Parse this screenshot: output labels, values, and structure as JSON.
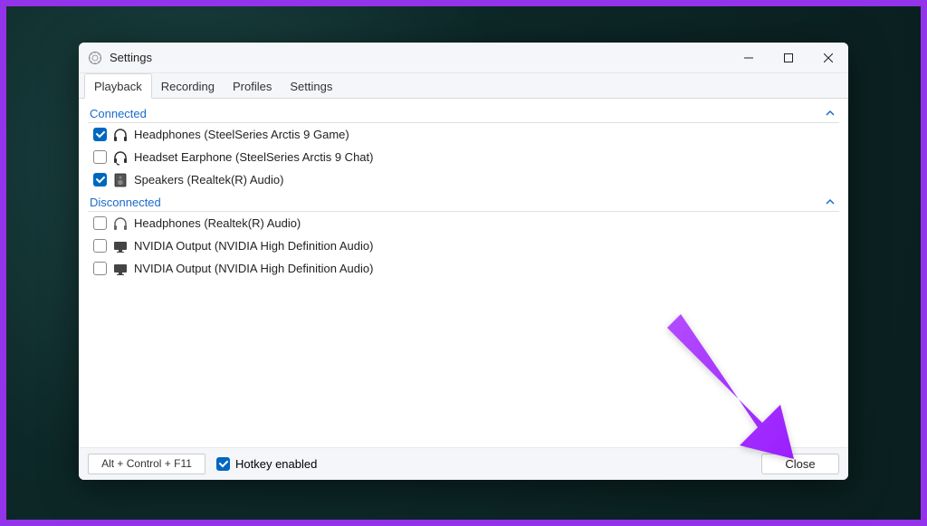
{
  "window": {
    "title": "Settings"
  },
  "tabs": [
    {
      "label": "Playback",
      "active": true
    },
    {
      "label": "Recording",
      "active": false
    },
    {
      "label": "Profiles",
      "active": false
    },
    {
      "label": "Settings",
      "active": false
    }
  ],
  "sections": {
    "connected": {
      "title": "Connected",
      "devices": [
        {
          "checked": true,
          "icon": "headphones",
          "label": "Headphones (SteelSeries Arctis 9 Game)"
        },
        {
          "checked": false,
          "icon": "headset",
          "label": "Headset Earphone (SteelSeries Arctis 9 Chat)"
        },
        {
          "checked": true,
          "icon": "speakers",
          "label": "Speakers (Realtek(R) Audio)"
        }
      ]
    },
    "disconnected": {
      "title": "Disconnected",
      "devices": [
        {
          "checked": false,
          "icon": "headphones",
          "label": "Headphones (Realtek(R) Audio)"
        },
        {
          "checked": false,
          "icon": "monitor",
          "label": "NVIDIA Output (NVIDIA High Definition Audio)"
        },
        {
          "checked": false,
          "icon": "monitor",
          "label": "NVIDIA Output (NVIDIA High Definition Audio)"
        }
      ]
    }
  },
  "footer": {
    "hotkey": "Alt + Control + F11",
    "hotkey_enabled_label": "Hotkey enabled",
    "hotkey_enabled": true,
    "close_label": "Close"
  },
  "colors": {
    "accent": "#0067c0",
    "section_header": "#1a6bcc",
    "annotation": "#a733ff",
    "border": "#9333ea"
  }
}
